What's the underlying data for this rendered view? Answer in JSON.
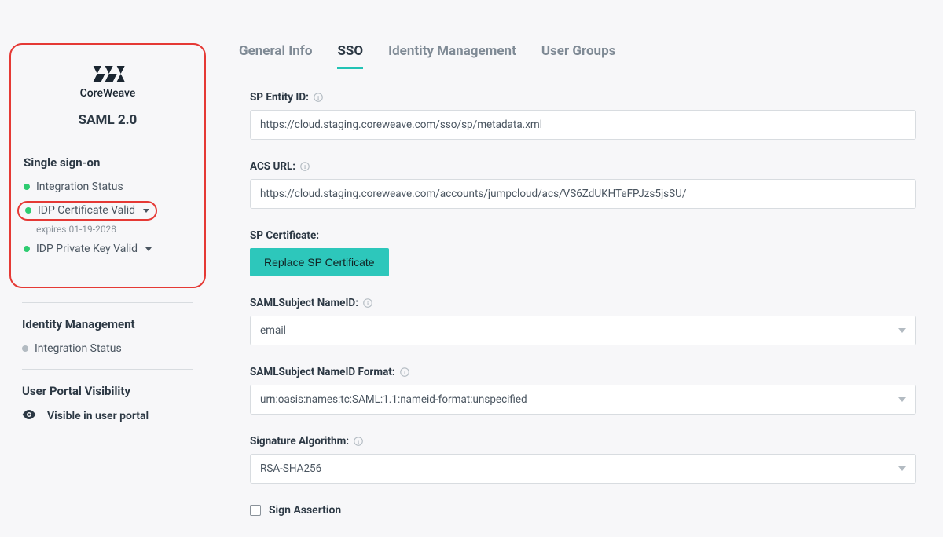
{
  "sidebar": {
    "logo_name": "CoreWeave",
    "protocol_title": "SAML 2.0",
    "sso": {
      "section_title": "Single sign-on",
      "items": [
        {
          "label": "Integration Status",
          "dot": "green",
          "chevron": false
        },
        {
          "label": "IDP Certificate Valid",
          "dot": "green",
          "chevron": true,
          "highlight": true,
          "sub": "expires 01-19-2028"
        },
        {
          "label": "IDP Private Key Valid",
          "dot": "green",
          "chevron": true
        }
      ]
    },
    "idm": {
      "section_title": "Identity Management",
      "items": [
        {
          "label": "Integration Status",
          "dot": "grey",
          "chevron": false
        }
      ]
    },
    "portal": {
      "section_title": "User Portal Visibility",
      "visible_label": "Visible in user portal"
    }
  },
  "tabs": [
    {
      "label": "General Info",
      "active": false
    },
    {
      "label": "SSO",
      "active": true
    },
    {
      "label": "Identity Management",
      "active": false
    },
    {
      "label": "User Groups",
      "active": false
    }
  ],
  "form": {
    "sp_entity_id": {
      "label": "SP Entity ID:",
      "value": "https://cloud.staging.coreweave.com/sso/sp/metadata.xml"
    },
    "acs_url": {
      "label": "ACS URL:",
      "value": "https://cloud.staging.coreweave.com/accounts/jumpcloud/acs/VS6ZdUKHTeFPJzs5jsSU/"
    },
    "sp_cert": {
      "label": "SP Certificate:",
      "button": "Replace SP Certificate"
    },
    "nameid": {
      "label": "SAMLSubject NameID:",
      "value": "email"
    },
    "nameid_format": {
      "label": "SAMLSubject NameID Format:",
      "value": "urn:oasis:names:tc:SAML:1.1:nameid-format:unspecified"
    },
    "sig_algo": {
      "label": "Signature Algorithm:",
      "value": "RSA-SHA256"
    },
    "sign_assertion": {
      "label": "Sign Assertion",
      "checked": false
    }
  },
  "colors": {
    "accent_teal": "#2dc7bb",
    "highlight_red": "#e53935",
    "status_green": "#2ecc71",
    "status_grey": "#b3bbc2"
  }
}
